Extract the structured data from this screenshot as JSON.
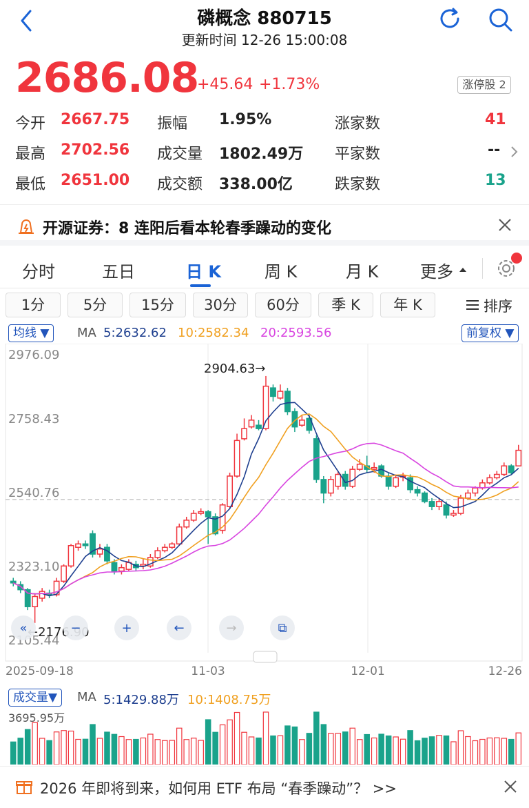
{
  "header": {
    "title": "磷概念 880715",
    "update_time": "更新时间 12-26 15:00:08"
  },
  "quote": {
    "price": "2686.08",
    "change": "+45.64",
    "change_pct": "+1.73%",
    "limit_up_label": "涨停股 2"
  },
  "stats": {
    "open_label": "今开",
    "open": "2667.75",
    "high_label": "最高",
    "high": "2702.56",
    "low_label": "最低",
    "low": "2651.00",
    "amp_label": "振幅",
    "amp": "1.95%",
    "vol_label": "成交量",
    "vol": "1802.49万",
    "amt_label": "成交额",
    "amt": "338.00亿",
    "up_label": "涨家数",
    "up": "41",
    "flat_label": "平家数",
    "flat": "--",
    "down_label": "跌家数",
    "down": "13"
  },
  "news": "开源证券：8 连阳后看本轮春季躁动的变化",
  "tabs": [
    "分时",
    "五日",
    "日 K",
    "周 K",
    "月 K",
    "更多"
  ],
  "periods": [
    "1分",
    "5分",
    "15分",
    "30分",
    "60分",
    "季 K",
    "年 K"
  ],
  "sort_label": "排序",
  "ma_bar": {
    "indicator": "均线",
    "ma_label": "MA",
    "ma5": "5:2632.62",
    "ma10": "10:2582.34",
    "ma20": "20:2593.56",
    "adjust": "前复权"
  },
  "vol_bar": {
    "indicator": "成交量",
    "ma_label": "MA",
    "ma5": "5:1429.88万",
    "ma10": "10:1408.75万",
    "max_label": "3695.95万"
  },
  "chart_data": {
    "type": "candlestick",
    "y_ticks": [
      "2976.09",
      "2758.43",
      "2540.76",
      "2323.10",
      "2105.44"
    ],
    "ylim": [
      2105.44,
      2976.09
    ],
    "x_ticks": [
      "2025-09-18",
      "11-03",
      "12-01",
      "12-26"
    ],
    "high_annotation": "2904.63→",
    "low_annotation": "←2176.90",
    "candles": [
      [
        2300,
        2295,
        2310,
        2285
      ],
      [
        2290,
        2275,
        2300,
        2265
      ],
      [
        2275,
        2225,
        2280,
        2215
      ],
      [
        2225,
        2255,
        2265,
        2177
      ],
      [
        2250,
        2270,
        2280,
        2240
      ],
      [
        2265,
        2260,
        2275,
        2250
      ],
      [
        2260,
        2300,
        2310,
        2255
      ],
      [
        2300,
        2345,
        2350,
        2295
      ],
      [
        2345,
        2405,
        2410,
        2340
      ],
      [
        2400,
        2410,
        2420,
        2390
      ],
      [
        2410,
        2405,
        2420,
        2395
      ],
      [
        2440,
        2380,
        2450,
        2370
      ],
      [
        2380,
        2395,
        2410,
        2370
      ],
      [
        2400,
        2360,
        2410,
        2350
      ],
      [
        2355,
        2330,
        2365,
        2320
      ],
      [
        2330,
        2340,
        2350,
        2320
      ],
      [
        2335,
        2355,
        2365,
        2330
      ],
      [
        2350,
        2340,
        2360,
        2330
      ],
      [
        2345,
        2350,
        2365,
        2335
      ],
      [
        2345,
        2370,
        2380,
        2340
      ],
      [
        2370,
        2390,
        2400,
        2365
      ],
      [
        2390,
        2400,
        2410,
        2385
      ],
      [
        2400,
        2410,
        2415,
        2395
      ],
      [
        2410,
        2460,
        2470,
        2405
      ],
      [
        2460,
        2480,
        2490,
        2455
      ],
      [
        2480,
        2500,
        2510,
        2475
      ],
      [
        2500,
        2505,
        2515,
        2495
      ],
      [
        2505,
        2490,
        2510,
        2410
      ],
      [
        2490,
        2440,
        2500,
        2435
      ],
      [
        2450,
        2525,
        2530,
        2440
      ],
      [
        2520,
        2610,
        2620,
        2515
      ],
      [
        2610,
        2715,
        2735,
        2605
      ],
      [
        2720,
        2750,
        2780,
        2715
      ],
      [
        2755,
        2775,
        2790,
        2750
      ],
      [
        2760,
        2750,
        2775,
        2745
      ],
      [
        2750,
        2875,
        2905,
        2745
      ],
      [
        2870,
        2845,
        2880,
        2830
      ],
      [
        2840,
        2860,
        2880,
        2835
      ],
      [
        2860,
        2800,
        2870,
        2790
      ],
      [
        2800,
        2755,
        2810,
        2740
      ],
      [
        2760,
        2775,
        2790,
        2755
      ],
      [
        2780,
        2745,
        2790,
        2735
      ],
      [
        2720,
        2600,
        2730,
        2590
      ],
      [
        2600,
        2560,
        2610,
        2530
      ],
      [
        2560,
        2600,
        2610,
        2550
      ],
      [
        2580,
        2615,
        2625,
        2570
      ],
      [
        2615,
        2580,
        2625,
        2570
      ],
      [
        2580,
        2630,
        2640,
        2575
      ],
      [
        2630,
        2645,
        2660,
        2625
      ],
      [
        2640,
        2630,
        2670,
        2620
      ],
      [
        2630,
        2635,
        2650,
        2620
      ],
      [
        2640,
        2610,
        2645,
        2605
      ],
      [
        2610,
        2580,
        2620,
        2570
      ],
      [
        2580,
        2605,
        2615,
        2575
      ],
      [
        2610,
        2610,
        2620,
        2595
      ],
      [
        2605,
        2570,
        2615,
        2560
      ],
      [
        2570,
        2560,
        2580,
        2550
      ],
      [
        2560,
        2535,
        2565,
        2530
      ],
      [
        2535,
        2520,
        2545,
        2510
      ],
      [
        2520,
        2535,
        2545,
        2510
      ],
      [
        2525,
        2495,
        2535,
        2485
      ],
      [
        2495,
        2500,
        2510,
        2490
      ],
      [
        2500,
        2545,
        2555,
        2495
      ],
      [
        2545,
        2560,
        2570,
        2540
      ],
      [
        2560,
        2575,
        2580,
        2550
      ],
      [
        2575,
        2590,
        2600,
        2570
      ],
      [
        2590,
        2605,
        2615,
        2585
      ],
      [
        2605,
        2615,
        2625,
        2600
      ],
      [
        2615,
        2640,
        2650,
        2610
      ],
      [
        2640,
        2620,
        2645,
        2615
      ],
      [
        2640,
        2686,
        2702,
        2651
      ]
    ],
    "ma5_color": "#1e3f8f",
    "ma10_color": "#f0a020",
    "ma20_color": "#d845e0"
  },
  "bottom_banner": "2026 年即将到来，如何用 ETF 布局 “春季躁动”？ >>",
  "colors": {
    "up": "#f0353d",
    "down": "#1aa38b",
    "accent": "#1a63d6"
  }
}
